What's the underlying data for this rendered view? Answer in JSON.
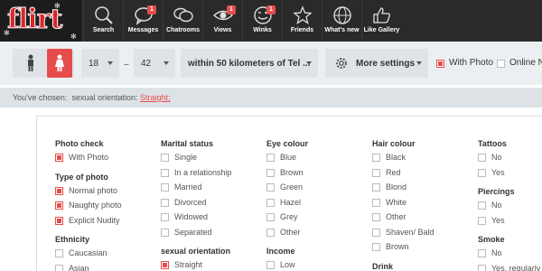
{
  "nav": {
    "logo_text": "flirt",
    "items": [
      {
        "label": "Search",
        "icon": "search-icon",
        "badge": ""
      },
      {
        "label": "Messages",
        "icon": "message-icon",
        "badge": "1"
      },
      {
        "label": "Chatrooms",
        "icon": "chatrooms-icon",
        "badge": ""
      },
      {
        "label": "Views",
        "icon": "eye-icon",
        "badge": "1"
      },
      {
        "label": "Winks",
        "icon": "wink-icon",
        "badge": "1"
      },
      {
        "label": "Friends",
        "icon": "star-icon",
        "badge": ""
      },
      {
        "label": "What's new",
        "icon": "globe-icon",
        "badge": ""
      },
      {
        "label": "Like Gallery",
        "icon": "thumbs-up-icon",
        "badge": ""
      }
    ]
  },
  "filters": {
    "age_from": "18",
    "age_separator": "–",
    "age_to": "42",
    "distance": "within 50 kilometers of Tel ...",
    "more_settings": "More settings",
    "with_photo": "With Photo",
    "online_now": "Online No"
  },
  "chosen": {
    "prefix": "You've chosen:",
    "label": "sexual orientation:",
    "value": "Straight;"
  },
  "options": {
    "photo_check": {
      "title": "Photo check",
      "items": [
        {
          "label": "With Photo",
          "checked": true
        }
      ]
    },
    "type_of_photo": {
      "title": "Type of photo",
      "items": [
        {
          "label": "Normal photo",
          "checked": true
        },
        {
          "label": "Naughty photo",
          "checked": true
        },
        {
          "label": "Explicit Nudity",
          "checked": true
        }
      ]
    },
    "ethnicity": {
      "title": "Ethnicity",
      "items": [
        {
          "label": "Caucasian",
          "checked": false
        },
        {
          "label": "Asian",
          "checked": false
        }
      ]
    },
    "marital_status": {
      "title": "Marital status",
      "items": [
        {
          "label": "Single",
          "checked": false
        },
        {
          "label": "In a relationship",
          "checked": false
        },
        {
          "label": "Married",
          "checked": false
        },
        {
          "label": "Divorced",
          "checked": false
        },
        {
          "label": "Widowed",
          "checked": false
        },
        {
          "label": "Separated",
          "checked": false
        }
      ]
    },
    "sexual_orientation": {
      "title": "sexual orientation",
      "items": [
        {
          "label": "Straight",
          "checked": true
        }
      ]
    },
    "eye_colour": {
      "title": "Eye colour",
      "items": [
        {
          "label": "Blue",
          "checked": false
        },
        {
          "label": "Brown",
          "checked": false
        },
        {
          "label": "Green",
          "checked": false
        },
        {
          "label": "Hazel",
          "checked": false
        },
        {
          "label": "Grey",
          "checked": false
        },
        {
          "label": "Other",
          "checked": false
        }
      ]
    },
    "income": {
      "title": "Income",
      "items": [
        {
          "label": "Low",
          "checked": false
        }
      ]
    },
    "hair_colour": {
      "title": "Hair colour",
      "items": [
        {
          "label": "Black",
          "checked": false
        },
        {
          "label": "Red",
          "checked": false
        },
        {
          "label": "Blond",
          "checked": false
        },
        {
          "label": "White",
          "checked": false
        },
        {
          "label": "Other",
          "checked": false
        },
        {
          "label": "Shaven/ Bald",
          "checked": false
        },
        {
          "label": "Brown",
          "checked": false
        }
      ]
    },
    "drink": {
      "title": "Drink",
      "items": []
    },
    "tattoos": {
      "title": "Tattoos",
      "items": [
        {
          "label": "No",
          "checked": false
        },
        {
          "label": "Yes",
          "checked": false
        }
      ]
    },
    "piercings": {
      "title": "Piercings",
      "items": [
        {
          "label": "No",
          "checked": false
        },
        {
          "label": "Yes",
          "checked": false
        }
      ]
    },
    "smoke": {
      "title": "Smoke",
      "items": [
        {
          "label": "No",
          "checked": false
        },
        {
          "label": "Yes, regularly",
          "checked": false
        }
      ]
    }
  },
  "colors": {
    "accent": "#e74c4c",
    "nav_bg": "#2a2a2a",
    "filter_bg": "#eceff2"
  }
}
